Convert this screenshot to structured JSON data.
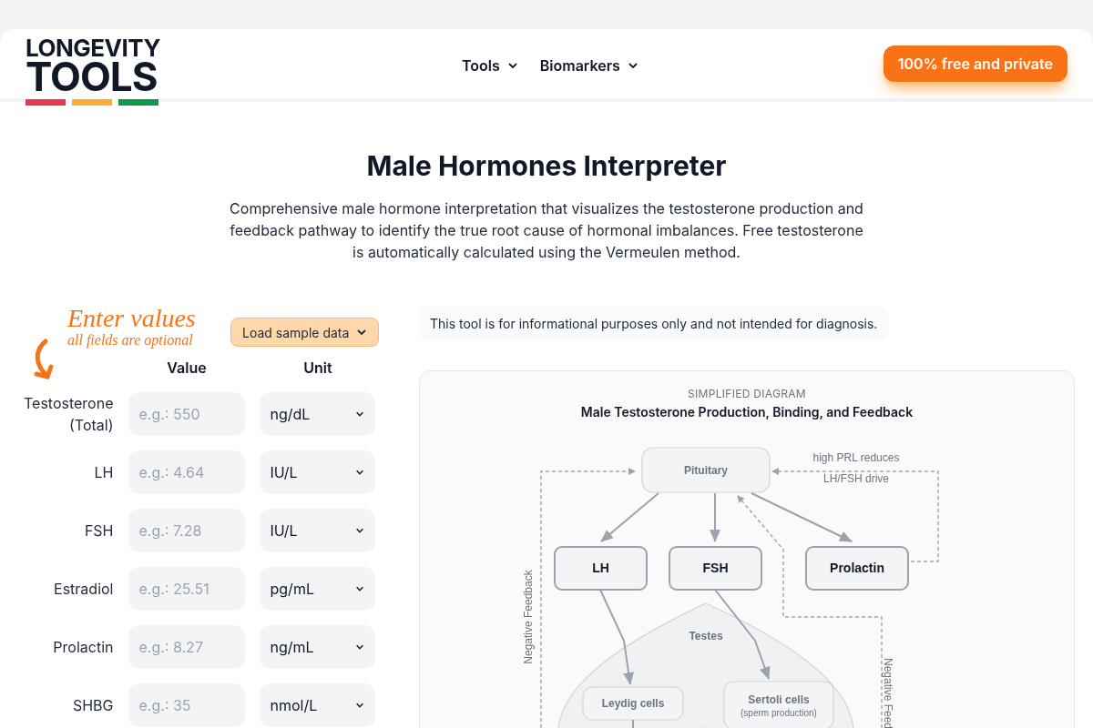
{
  "header": {
    "logo": {
      "line1": "LONGEVITY",
      "line2": "TOOLS"
    },
    "nav": [
      {
        "label": "Tools",
        "expanded": false
      },
      {
        "label": "Biomarkers",
        "expanded": false
      }
    ],
    "cta": "100% free and private"
  },
  "page": {
    "title": "Male Hormones Interpreter",
    "description": "Comprehensive male hormone interpretation that visualizes the testosterone production and feedback pathway to identify the true root cause of hormonal imbalances. Free testosterone is automatically calculated using the Vermeulen method."
  },
  "form": {
    "hint_title": "Enter values",
    "hint_subtitle": "all fields are optional",
    "sample_button": "Load sample data",
    "columns": [
      "Value",
      "Unit"
    ],
    "rows": [
      {
        "label": "Testosterone (Total)",
        "placeholder": "e.g.: 550",
        "unit": "ng/dL"
      },
      {
        "label": "LH",
        "placeholder": "e.g.: 4.64",
        "unit": "IU/L"
      },
      {
        "label": "FSH",
        "placeholder": "e.g.: 7.28",
        "unit": "IU/L"
      },
      {
        "label": "Estradiol",
        "placeholder": "e.g.: 25.51",
        "unit": "pg/mL"
      },
      {
        "label": "Prolactin",
        "placeholder": "e.g.: 8.27",
        "unit": "ng/mL"
      },
      {
        "label": "SHBG",
        "placeholder": "e.g.: 35",
        "unit": "nmol/L"
      }
    ]
  },
  "disclaimer": "This tool is for informational purposes only and not intended for diagnosis.",
  "diagram": {
    "eyebrow": "SIMPLIFIED DIAGRAM",
    "title": "Male Testosterone Production, Binding, and Feedback",
    "nodes": [
      {
        "kind": "pituitary",
        "label": "Pituitary"
      },
      {
        "kind": "hormone",
        "label": "LH"
      },
      {
        "kind": "hormone",
        "label": "FSH"
      },
      {
        "kind": "hormone",
        "label": "Prolactin"
      },
      {
        "kind": "cell",
        "label": "Leydig cells"
      },
      {
        "kind": "cell",
        "label": "Sertoli cells",
        "sublabel": "(sperm production)"
      }
    ],
    "testes_label": "Testes",
    "prl_note": [
      "high PRL reduces",
      "LH/FSH drive"
    ],
    "feedback_left": "Negative Feedback",
    "feedback_right": "Negative Feed"
  }
}
